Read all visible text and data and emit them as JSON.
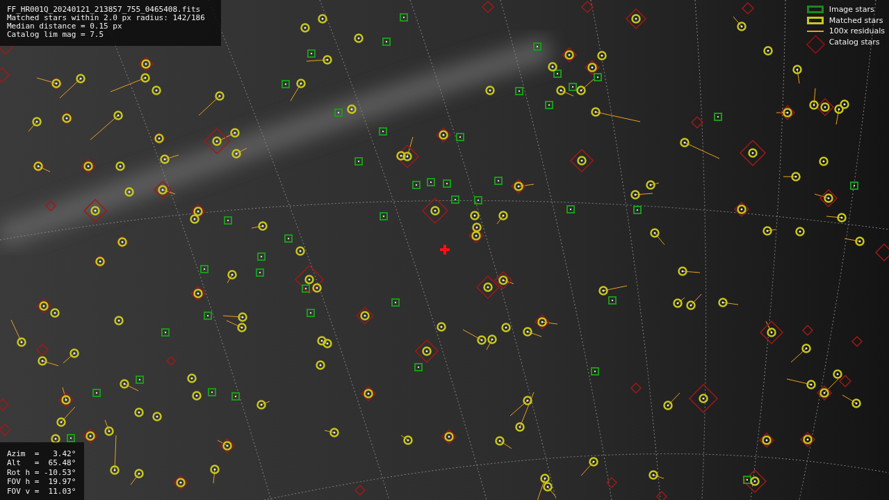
{
  "info_lines": [
    "FF_HR001Q_20240121_213857_755_0465408.fits",
    "Matched stars within 2.0 px radius: 142/186",
    "Median distance = 0.15 px",
    "Catalog lim mag = 7.5"
  ],
  "legend": [
    {
      "kind": "image",
      "label": "Image stars"
    },
    {
      "kind": "matched",
      "label": "Matched stars"
    },
    {
      "kind": "residual",
      "label": "100x residuals"
    },
    {
      "kind": "catalog",
      "label": "Catalog stars"
    }
  ],
  "pointing_lines": [
    "Azim  =   3.42°",
    "Alt   =  65.48°",
    "Rot h = -10.53°",
    "FOV h =  19.97°",
    "FOV v =  11.03°"
  ]
}
